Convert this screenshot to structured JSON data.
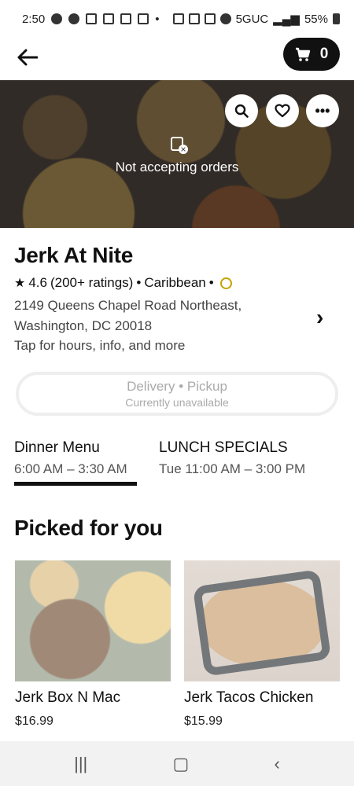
{
  "status_bar": {
    "time": "2:50",
    "network": "5GUC",
    "battery": "55%"
  },
  "header": {
    "cart_count": "0"
  },
  "hero": {
    "status_text": "Not accepting orders"
  },
  "store": {
    "name": "Jerk At Nite",
    "rating": "4.6",
    "ratings_count": "(200+ ratings)",
    "cuisine": "Caribbean",
    "address": "2149 Queens Chapel Road Northeast, Washington, DC 20018",
    "more": "Tap for hours, info, and more"
  },
  "mode": {
    "delivery": "Delivery",
    "separator": "•",
    "pickup": "Pickup",
    "status": "Currently unavailable"
  },
  "menus": [
    {
      "name": "Dinner Menu",
      "hours": "6:00 AM – 3:30 AM"
    },
    {
      "name": "LUNCH SPECIALS",
      "hours": "Tue 11:00 AM – 3:00 PM"
    }
  ],
  "section": {
    "title": "Picked for you"
  },
  "items": [
    {
      "name": "Jerk Box N Mac",
      "price": "$16.99"
    },
    {
      "name": "Jerk Tacos Chicken",
      "price": "$15.99"
    }
  ],
  "icons": {
    "back": "arrow-left-icon",
    "cart": "cart-icon",
    "search": "search-icon",
    "favorite": "heart-icon",
    "more": "more-icon"
  }
}
